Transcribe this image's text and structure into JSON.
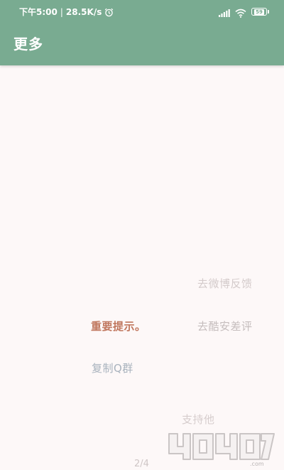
{
  "status_bar": {
    "time": "下午5:00",
    "separator": "|",
    "network_speed": "28.5K/s",
    "battery_level": "59",
    "icons": [
      "alarm-icon",
      "signal-icon",
      "wifi-icon",
      "battery-icon"
    ]
  },
  "app_bar": {
    "title": "更多"
  },
  "menu": {
    "weibo_feedback": "去微博反馈",
    "coolapk_review": "去酷安差评",
    "important_notice": "重要提示。",
    "copy_qq_group": "复制Q群",
    "support_him": "支持他"
  },
  "page_indicator": "2/4",
  "watermark": {
    "text": "4O4O7.com"
  },
  "colors": {
    "header": "#79ab91",
    "background": "#fdf8f8",
    "notice": "#c0765d",
    "copy": "#a8b2bd",
    "faded": "#d4cbcb"
  }
}
